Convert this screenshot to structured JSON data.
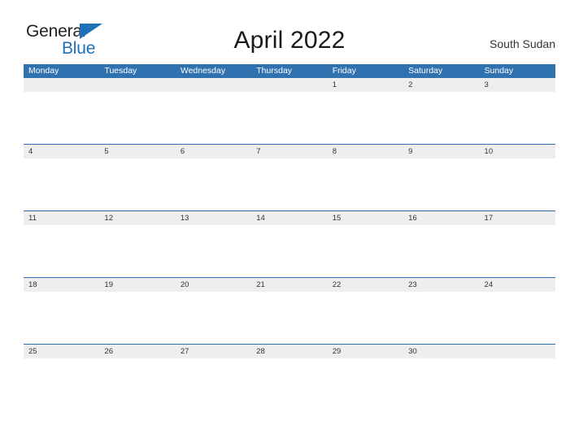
{
  "logo": {
    "word1": "General",
    "word2": "Blue",
    "triangle_color": "#1d71b8",
    "text_color": "#231f20"
  },
  "header": {
    "title": "April 2022",
    "locale": "South Sudan"
  },
  "theme": {
    "header_blue": "#3071b0",
    "band_gray": "#eeeeee",
    "page_background": "#ffffff",
    "date_text": "#333333"
  },
  "calendar": {
    "month": "April",
    "year": "2022",
    "weekday_headers": [
      "Monday",
      "Tuesday",
      "Wednesday",
      "Thursday",
      "Friday",
      "Saturday",
      "Sunday"
    ],
    "weeks": [
      {
        "days": [
          "",
          "",
          "",
          "",
          "1",
          "2",
          "3"
        ]
      },
      {
        "days": [
          "4",
          "5",
          "6",
          "7",
          "8",
          "9",
          "10"
        ]
      },
      {
        "days": [
          "11",
          "12",
          "13",
          "14",
          "15",
          "16",
          "17"
        ]
      },
      {
        "days": [
          "18",
          "19",
          "20",
          "21",
          "22",
          "23",
          "24"
        ]
      },
      {
        "days": [
          "25",
          "26",
          "27",
          "28",
          "29",
          "30",
          ""
        ]
      }
    ]
  }
}
